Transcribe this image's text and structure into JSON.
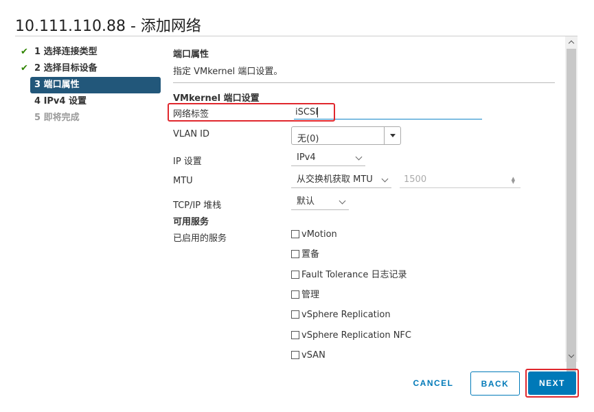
{
  "dialog": {
    "title": "10.111.110.88 - 添加网络"
  },
  "steps": [
    {
      "label": "1 选择连接类型",
      "state": "done"
    },
    {
      "label": "2 选择目标设备",
      "state": "done"
    },
    {
      "label": "3 端口属性",
      "state": "active"
    },
    {
      "label": "4 IPv4 设置",
      "state": "pending"
    },
    {
      "label": "5 即将完成",
      "state": "disabled"
    }
  ],
  "content": {
    "section_title": "端口属性",
    "section_desc": "指定 VMkernel 端口设置。",
    "subsection_title": "VMkernel 端口设置"
  },
  "form": {
    "network_label": {
      "label": "网络标签",
      "value": "iSCSI"
    },
    "vlan_id": {
      "label": "VLAN ID",
      "value": "无(0)"
    },
    "ip_settings": {
      "label": "IP 设置",
      "value": "IPv4"
    },
    "mtu": {
      "label": "MTU",
      "mode": "从交换机获取 MTU",
      "value": "1500"
    },
    "tcpip_stack": {
      "label": "TCP/IP 堆栈",
      "value": "默认"
    }
  },
  "services": {
    "title": "可用服务",
    "enabled_label": "已启用的服务",
    "items": [
      {
        "label": "vMotion",
        "checked": false
      },
      {
        "label": "置备",
        "checked": false
      },
      {
        "label": "Fault Tolerance 日志记录",
        "checked": false
      },
      {
        "label": "管理",
        "checked": false
      },
      {
        "label": "vSphere Replication",
        "checked": false
      },
      {
        "label": "vSphere Replication NFC",
        "checked": false
      },
      {
        "label": "vSAN",
        "checked": false
      }
    ]
  },
  "footer": {
    "cancel_label": "CANCEL",
    "back_label": "BACK",
    "next_label": "NEXT"
  },
  "colors": {
    "accent": "#0079b8",
    "active_step": "#22577a",
    "check": "#2f8400",
    "highlight": "#e0262c"
  }
}
